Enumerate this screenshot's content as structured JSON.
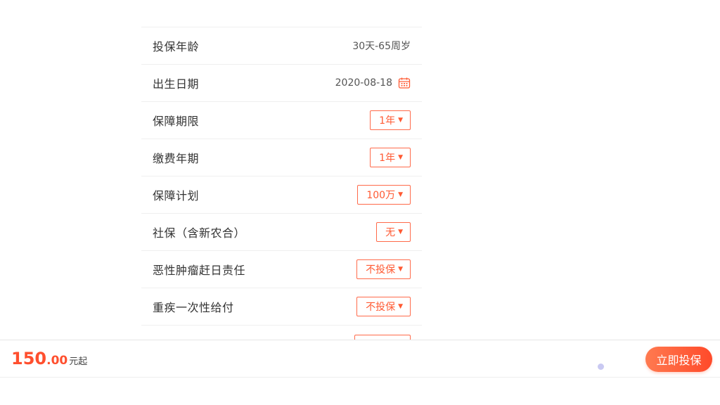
{
  "form": {
    "rows": [
      {
        "label": "投保年龄",
        "value": "30天-65周岁"
      },
      {
        "label": "出生日期",
        "value": "2020-08-18",
        "icon": "calendar-icon"
      },
      {
        "label": "保障期限",
        "select": "1年"
      },
      {
        "label": "缴费年期",
        "select": "1年"
      },
      {
        "label": "保障计划",
        "select": "100万"
      },
      {
        "label": "社保（含新农合）",
        "select": "无"
      },
      {
        "label": "恶性肿瘤赶日责任",
        "select": "不投保"
      },
      {
        "label": "重疾一次性给付",
        "select": "不投保"
      }
    ],
    "caret": "▼"
  },
  "bottom": {
    "price_int": "150",
    "price_dec": ".00",
    "price_suffix": "元起",
    "buy_label": "立即投保"
  },
  "colors": {
    "accent": "#ff5a33",
    "border": "#efefef"
  }
}
